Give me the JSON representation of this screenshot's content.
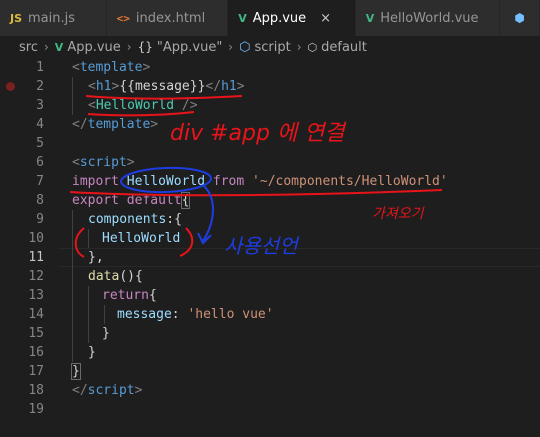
{
  "tabs": [
    {
      "label": "main.js",
      "icon": "js-file-icon",
      "icon_glyph": "JS",
      "active": false
    },
    {
      "label": "index.html",
      "icon": "html-file-icon",
      "icon_glyph": "<>",
      "active": false
    },
    {
      "label": "App.vue",
      "icon": "vue-file-icon",
      "icon_glyph": "V",
      "active": true
    },
    {
      "label": "HelloWorld.vue",
      "icon": "vue-file-icon",
      "icon_glyph": "V",
      "active": false
    }
  ],
  "close_glyph": "×",
  "breadcrumb": {
    "folder": "src",
    "file": "App.vue",
    "braces_glyph": "{}",
    "object": "\"App.vue\"",
    "section": "script",
    "symbol": "default",
    "separator": "›"
  },
  "editor": {
    "current_line": 11,
    "breakpoint_line": 2,
    "lines": [
      {
        "n": "1"
      },
      {
        "n": "2"
      },
      {
        "n": "3"
      },
      {
        "n": "4"
      },
      {
        "n": "5"
      },
      {
        "n": "6"
      },
      {
        "n": "7"
      },
      {
        "n": "8"
      },
      {
        "n": "9"
      },
      {
        "n": "10"
      },
      {
        "n": "11"
      },
      {
        "n": "12"
      },
      {
        "n": "13"
      },
      {
        "n": "14"
      },
      {
        "n": "15"
      },
      {
        "n": "16"
      },
      {
        "n": "17"
      },
      {
        "n": "18"
      },
      {
        "n": "19"
      }
    ],
    "tokens": {
      "open_lt": "<",
      "gt": ">",
      "close_lt": "</",
      "self_close": " />",
      "template": "template",
      "h1": "h1",
      "message_expr": "{{message}}",
      "helloworld": "HelloWorld",
      "script": "script",
      "import": "import",
      "from": "from",
      "import_path": "'~/components/HelloWorld'",
      "export": "export",
      "default": "default",
      "brace_open": "{",
      "components": "components",
      "colon_brace": ":{",
      "comma_close": "},",
      "data": "data",
      "data_parens": "(){",
      "return": "return",
      "message": "message",
      "colon": ": ",
      "hello_str": "'hello vue'",
      "brace_close": "}"
    }
  },
  "annotations": {
    "div_app": "div #app 에 연결",
    "import_note": "가져오기",
    "use_note": "사용선언"
  },
  "colors": {
    "annotation_red": "#e8141a",
    "annotation_blue": "#1e3de0",
    "editor_bg": "#1e1e1e",
    "tab_bar_bg": "#252526",
    "vue_green": "#41b883"
  }
}
